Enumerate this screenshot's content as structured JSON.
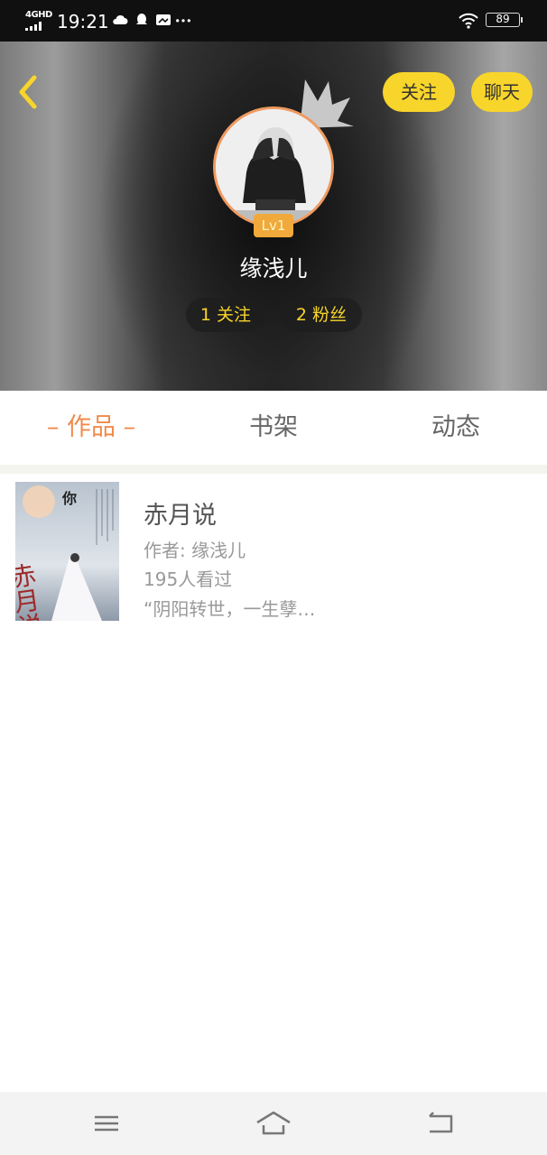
{
  "status_bar": {
    "network": "4GHD",
    "time": "19:21",
    "battery": "89",
    "icons": [
      "weather-cloud-icon",
      "qq-icon",
      "message-icon",
      "more-dots-icon"
    ]
  },
  "header": {
    "back_icon": "chevron-left-icon",
    "follow_label": "关注",
    "chat_label": "聊天",
    "level": "Lv1",
    "username": "缘浅儿",
    "following": "1 关注",
    "followers": "2 粉丝"
  },
  "tabs": [
    {
      "label": "– 作品 –",
      "active": true
    },
    {
      "label": "书架",
      "active": false
    },
    {
      "label": "动态",
      "active": false
    }
  ],
  "works": [
    {
      "cover_title": "赤月说",
      "cover_text": "你",
      "title": "赤月说",
      "author": "作者: 缘浅儿",
      "views": "195人看过",
      "description": "“阴阳转世，一生孽…"
    }
  ],
  "navbar": {
    "icons": [
      "menu-icon",
      "home-icon",
      "back-icon"
    ]
  },
  "colors": {
    "accent_yellow": "#f8d52a",
    "active_tab": "#f08a4b",
    "avatar_ring": "#f09a5f",
    "level_badge": "#f0a93a"
  }
}
